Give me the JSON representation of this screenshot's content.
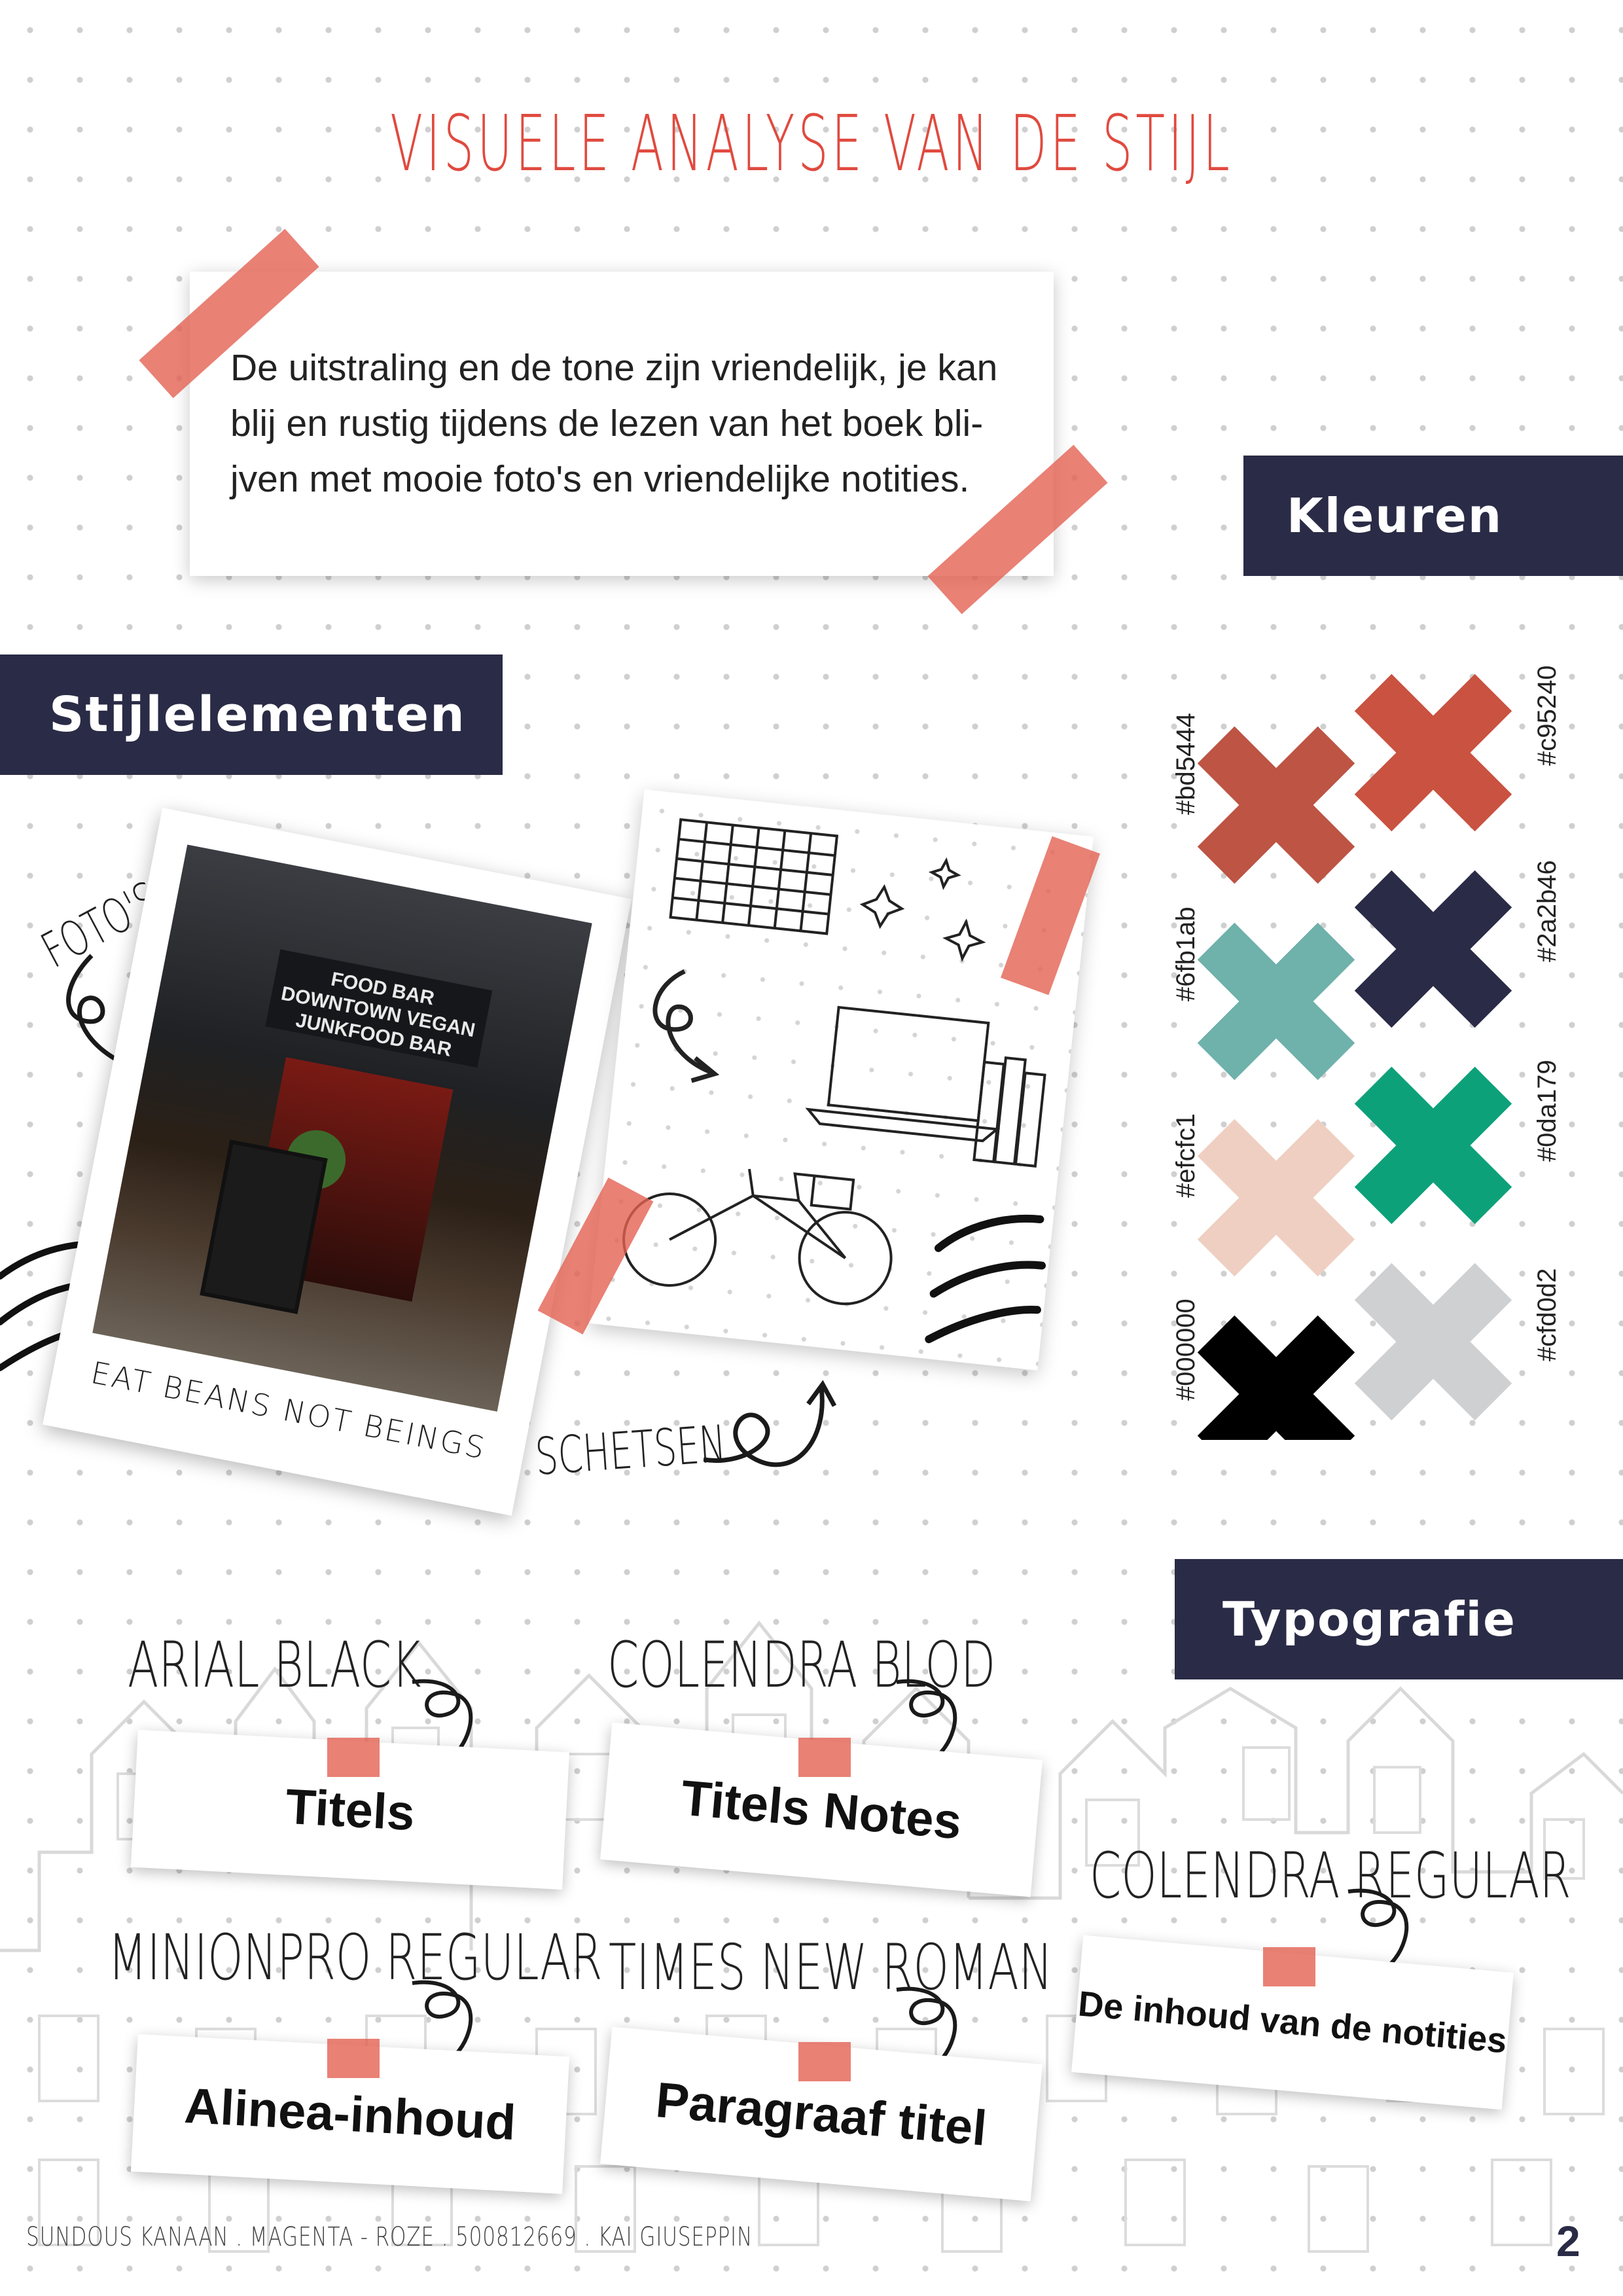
{
  "title": "VISUELE ANALYSE VAN DE STIJL",
  "intro_text": "De uitstraling en de tone zijn vriendelijk, je kan blij en rustig tijdens de lezen van het boek bli-jven met mooie foto's en vriendelijke notities.",
  "sections": {
    "kleuren": "Kleuren",
    "stijlelementen": "Stijlelementen",
    "typografie": "Typografie"
  },
  "stijlelementen": {
    "photos_label": "FOTO'S",
    "sketches_label": "SCHETSEN",
    "polaroid_caption": "EAT BEANS NOT BEINGS",
    "photo_sign_text": "FOOD BAR DOWNTOWN VEGAN JUNKFOOD BAR"
  },
  "colors": [
    {
      "hex": "#bd5444",
      "label": "#bd5444"
    },
    {
      "hex": "#c95240",
      "label": "#c95240"
    },
    {
      "hex": "#6fb1ab",
      "label": "#6fb1ab"
    },
    {
      "hex": "#2a2b46",
      "label": "#2a2b46"
    },
    {
      "hex": "#efcfc1",
      "label": "#efcfc1"
    },
    {
      "hex": "#0da179",
      "label": "#0da179"
    },
    {
      "hex": "#000000",
      "label": "#000000"
    },
    {
      "hex": "#cfd0d2",
      "label": "#cfd0d2"
    }
  ],
  "accent_color": "#e04a3f",
  "banner_color": "#2a2b46",
  "typography": [
    {
      "font": "ARIAL BLACK",
      "usage": "Titels"
    },
    {
      "font": "COLENDRA BLOD",
      "usage": "Titels Notes"
    },
    {
      "font": "COLENDRA REGULAR",
      "usage": "De inhoud van de notities"
    },
    {
      "font": "MINIONPRO REGULAR",
      "usage": "Alinea-inhoud"
    },
    {
      "font": "TIMES NEW ROMAN",
      "usage": "Paragraaf titel"
    }
  ],
  "footer": "SUNDOUS KANAAN . MAGENTA - ROZE . 500812669 . KAI GIUSEPPIN",
  "page_number": "2"
}
